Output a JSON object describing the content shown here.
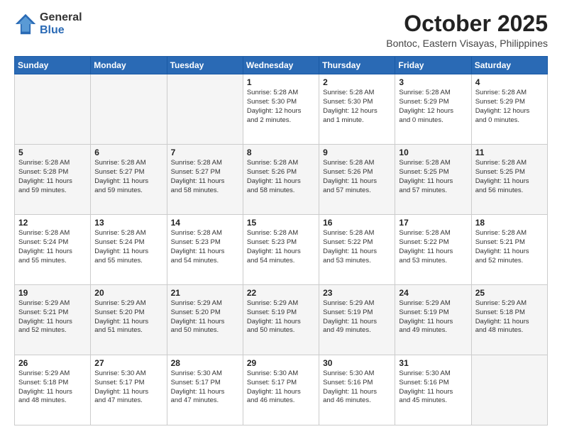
{
  "logo": {
    "general": "General",
    "blue": "Blue"
  },
  "header": {
    "month": "October 2025",
    "location": "Bontoc, Eastern Visayas, Philippines"
  },
  "weekdays": [
    "Sunday",
    "Monday",
    "Tuesday",
    "Wednesday",
    "Thursday",
    "Friday",
    "Saturday"
  ],
  "weeks": [
    [
      {
        "day": "",
        "info": ""
      },
      {
        "day": "",
        "info": ""
      },
      {
        "day": "",
        "info": ""
      },
      {
        "day": "1",
        "info": "Sunrise: 5:28 AM\nSunset: 5:30 PM\nDaylight: 12 hours\nand 2 minutes."
      },
      {
        "day": "2",
        "info": "Sunrise: 5:28 AM\nSunset: 5:30 PM\nDaylight: 12 hours\nand 1 minute."
      },
      {
        "day": "3",
        "info": "Sunrise: 5:28 AM\nSunset: 5:29 PM\nDaylight: 12 hours\nand 0 minutes."
      },
      {
        "day": "4",
        "info": "Sunrise: 5:28 AM\nSunset: 5:29 PM\nDaylight: 12 hours\nand 0 minutes."
      }
    ],
    [
      {
        "day": "5",
        "info": "Sunrise: 5:28 AM\nSunset: 5:28 PM\nDaylight: 11 hours\nand 59 minutes."
      },
      {
        "day": "6",
        "info": "Sunrise: 5:28 AM\nSunset: 5:27 PM\nDaylight: 11 hours\nand 59 minutes."
      },
      {
        "day": "7",
        "info": "Sunrise: 5:28 AM\nSunset: 5:27 PM\nDaylight: 11 hours\nand 58 minutes."
      },
      {
        "day": "8",
        "info": "Sunrise: 5:28 AM\nSunset: 5:26 PM\nDaylight: 11 hours\nand 58 minutes."
      },
      {
        "day": "9",
        "info": "Sunrise: 5:28 AM\nSunset: 5:26 PM\nDaylight: 11 hours\nand 57 minutes."
      },
      {
        "day": "10",
        "info": "Sunrise: 5:28 AM\nSunset: 5:25 PM\nDaylight: 11 hours\nand 57 minutes."
      },
      {
        "day": "11",
        "info": "Sunrise: 5:28 AM\nSunset: 5:25 PM\nDaylight: 11 hours\nand 56 minutes."
      }
    ],
    [
      {
        "day": "12",
        "info": "Sunrise: 5:28 AM\nSunset: 5:24 PM\nDaylight: 11 hours\nand 55 minutes."
      },
      {
        "day": "13",
        "info": "Sunrise: 5:28 AM\nSunset: 5:24 PM\nDaylight: 11 hours\nand 55 minutes."
      },
      {
        "day": "14",
        "info": "Sunrise: 5:28 AM\nSunset: 5:23 PM\nDaylight: 11 hours\nand 54 minutes."
      },
      {
        "day": "15",
        "info": "Sunrise: 5:28 AM\nSunset: 5:23 PM\nDaylight: 11 hours\nand 54 minutes."
      },
      {
        "day": "16",
        "info": "Sunrise: 5:28 AM\nSunset: 5:22 PM\nDaylight: 11 hours\nand 53 minutes."
      },
      {
        "day": "17",
        "info": "Sunrise: 5:28 AM\nSunset: 5:22 PM\nDaylight: 11 hours\nand 53 minutes."
      },
      {
        "day": "18",
        "info": "Sunrise: 5:28 AM\nSunset: 5:21 PM\nDaylight: 11 hours\nand 52 minutes."
      }
    ],
    [
      {
        "day": "19",
        "info": "Sunrise: 5:29 AM\nSunset: 5:21 PM\nDaylight: 11 hours\nand 52 minutes."
      },
      {
        "day": "20",
        "info": "Sunrise: 5:29 AM\nSunset: 5:20 PM\nDaylight: 11 hours\nand 51 minutes."
      },
      {
        "day": "21",
        "info": "Sunrise: 5:29 AM\nSunset: 5:20 PM\nDaylight: 11 hours\nand 50 minutes."
      },
      {
        "day": "22",
        "info": "Sunrise: 5:29 AM\nSunset: 5:19 PM\nDaylight: 11 hours\nand 50 minutes."
      },
      {
        "day": "23",
        "info": "Sunrise: 5:29 AM\nSunset: 5:19 PM\nDaylight: 11 hours\nand 49 minutes."
      },
      {
        "day": "24",
        "info": "Sunrise: 5:29 AM\nSunset: 5:19 PM\nDaylight: 11 hours\nand 49 minutes."
      },
      {
        "day": "25",
        "info": "Sunrise: 5:29 AM\nSunset: 5:18 PM\nDaylight: 11 hours\nand 48 minutes."
      }
    ],
    [
      {
        "day": "26",
        "info": "Sunrise: 5:29 AM\nSunset: 5:18 PM\nDaylight: 11 hours\nand 48 minutes."
      },
      {
        "day": "27",
        "info": "Sunrise: 5:30 AM\nSunset: 5:17 PM\nDaylight: 11 hours\nand 47 minutes."
      },
      {
        "day": "28",
        "info": "Sunrise: 5:30 AM\nSunset: 5:17 PM\nDaylight: 11 hours\nand 47 minutes."
      },
      {
        "day": "29",
        "info": "Sunrise: 5:30 AM\nSunset: 5:17 PM\nDaylight: 11 hours\nand 46 minutes."
      },
      {
        "day": "30",
        "info": "Sunrise: 5:30 AM\nSunset: 5:16 PM\nDaylight: 11 hours\nand 46 minutes."
      },
      {
        "day": "31",
        "info": "Sunrise: 5:30 AM\nSunset: 5:16 PM\nDaylight: 11 hours\nand 45 minutes."
      },
      {
        "day": "",
        "info": ""
      }
    ]
  ]
}
